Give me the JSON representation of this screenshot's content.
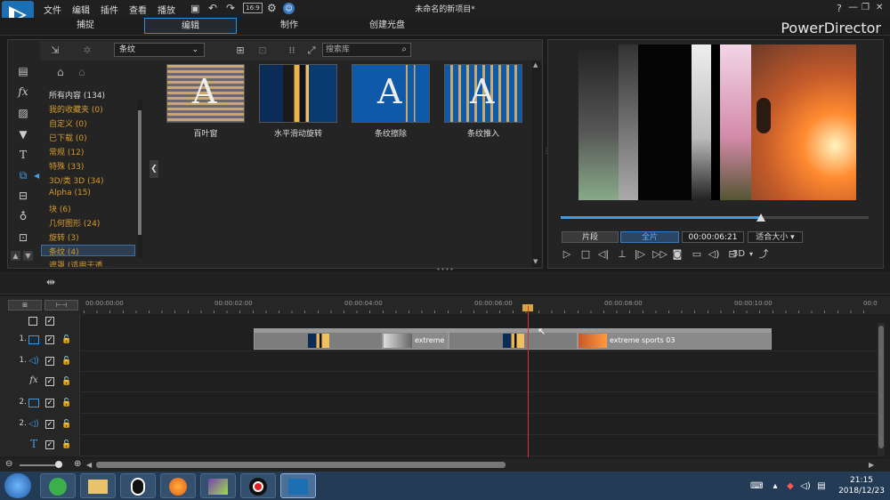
{
  "window": {
    "title": "未命名的新项目*",
    "brand": "PowerDirector",
    "controls": [
      "?",
      "—",
      "❐",
      "✕"
    ]
  },
  "menu": [
    "文件",
    "编辑",
    "插件",
    "查看",
    "播放"
  ],
  "modes": [
    "捕捉",
    "编辑",
    "制作",
    "创建光盘"
  ],
  "library": {
    "filter": "条纹",
    "search_placeholder": "搜索库",
    "categories": [
      "所有内容 (134)",
      "我的收藏夹 (0)",
      "自定义 (0)",
      "已下载 (0)",
      "常规 (12)",
      "特殊 (33)",
      "3D/类 3D (34)",
      "Alpha (15)",
      "块 (6)",
      "几何图形 (24)",
      "旋转 (3)",
      "条纹 (4)",
      "遮罩 (适用于透..."
    ],
    "thumbnails": [
      "百叶窗",
      "水平滑动旋转",
      "条纹擦除",
      "条纹推入"
    ],
    "thumbnail_letter": "A"
  },
  "preview": {
    "segment_btn": "片段",
    "full_btn": "全片",
    "timecode": "00:00:06:21",
    "fit": "适合大小",
    "stereo": "3D",
    "progress": 0.65
  },
  "timeline": {
    "ticks": [
      "00:00:00:00",
      "00:00:02:00",
      "00:00:04:00",
      "00:00:06:00",
      "00:00:08:00",
      "00:00:10:00",
      "00:0"
    ],
    "tracks": [
      {
        "num": "",
        "icon": "checkbox"
      },
      {
        "num": "1.",
        "icon": "video"
      },
      {
        "num": "1.",
        "icon": "audio"
      },
      {
        "num": "",
        "icon": "fx"
      },
      {
        "num": "2.",
        "icon": "video"
      },
      {
        "num": "2.",
        "icon": "audio"
      },
      {
        "num": "",
        "icon": "title"
      }
    ],
    "clips": [
      "extreme",
      "extreme sports 03"
    ]
  },
  "taskbar": {
    "time": "21:15",
    "date": "2018/12/23"
  },
  "colors": {
    "accent": "#3f9be3",
    "category": "#d49a2a",
    "playhead": "#dd3333"
  }
}
